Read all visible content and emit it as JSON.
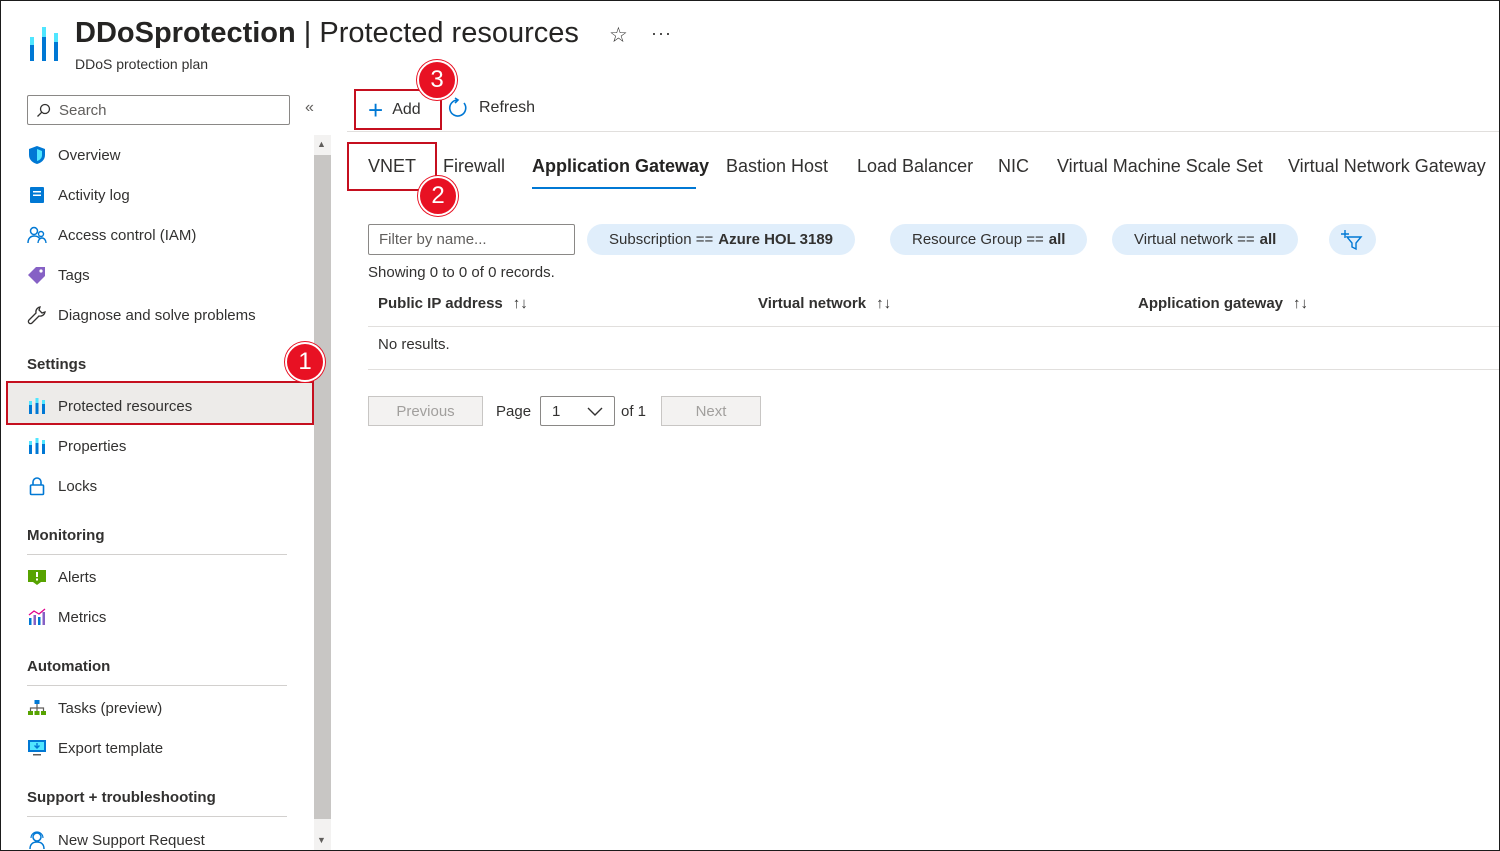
{
  "header": {
    "resource_name": "DDoSprotection",
    "separator": " | ",
    "page_title": "Protected resources",
    "subtitle": "DDoS protection plan",
    "favorite_glyph": "☆",
    "more_glyph": "···"
  },
  "sidebar": {
    "search_placeholder": "Search",
    "collapse_glyph": "«",
    "items": [
      {
        "label": "Overview",
        "icon": "shield-icon"
      },
      {
        "label": "Activity log",
        "icon": "activity-log-icon"
      },
      {
        "label": "Access control (IAM)",
        "icon": "people-icon"
      },
      {
        "label": "Tags",
        "icon": "tag-icon"
      },
      {
        "label": "Diagnose and solve problems",
        "icon": "wrench-icon"
      }
    ],
    "sections": [
      {
        "title": "Settings",
        "items": [
          {
            "label": "Protected resources",
            "icon": "ddos-plan-icon",
            "selected": true
          },
          {
            "label": "Properties",
            "icon": "properties-icon"
          },
          {
            "label": "Locks",
            "icon": "lock-icon"
          }
        ]
      },
      {
        "title": "Monitoring",
        "items": [
          {
            "label": "Alerts",
            "icon": "alert-icon"
          },
          {
            "label": "Metrics",
            "icon": "metrics-icon"
          }
        ]
      },
      {
        "title": "Automation",
        "items": [
          {
            "label": "Tasks (preview)",
            "icon": "tasks-icon"
          },
          {
            "label": "Export template",
            "icon": "export-template-icon"
          }
        ]
      },
      {
        "title": "Support + troubleshooting",
        "items": [
          {
            "label": "New Support Request",
            "icon": "support-request-icon"
          }
        ]
      }
    ]
  },
  "toolbar": {
    "add_label": "Add",
    "refresh_label": "Refresh"
  },
  "tabs": [
    {
      "label": "VNET"
    },
    {
      "label": "Firewall"
    },
    {
      "label": "Application Gateway",
      "active": true
    },
    {
      "label": "Bastion Host"
    },
    {
      "label": "Load Balancer"
    },
    {
      "label": "NIC"
    },
    {
      "label": "Virtual Machine Scale Set"
    },
    {
      "label": "Virtual Network Gateway"
    }
  ],
  "filters": {
    "name_placeholder": "Filter by name...",
    "pills": [
      {
        "key": "Subscription ==",
        "value": "Azure HOL 3189"
      },
      {
        "key": "Resource Group ==",
        "value": "all"
      },
      {
        "key": "Virtual network ==",
        "value": "all"
      }
    ]
  },
  "records_text": "Showing 0 to 0 of 0 records.",
  "table": {
    "columns": [
      {
        "label": "Public IP address"
      },
      {
        "label": "Virtual network"
      },
      {
        "label": "Application gateway"
      }
    ],
    "sort_glyph": "↑↓",
    "empty_text": "No results."
  },
  "pager": {
    "previous_label": "Previous",
    "page_label": "Page",
    "page_value": "1",
    "of_label": "of 1",
    "next_label": "Next"
  },
  "callouts": [
    "1",
    "2",
    "3"
  ],
  "colors": {
    "accent": "#0078d4",
    "highlight_border": "#c50f1f",
    "callout": "#e81123",
    "pill_background": "#e0eefb"
  }
}
